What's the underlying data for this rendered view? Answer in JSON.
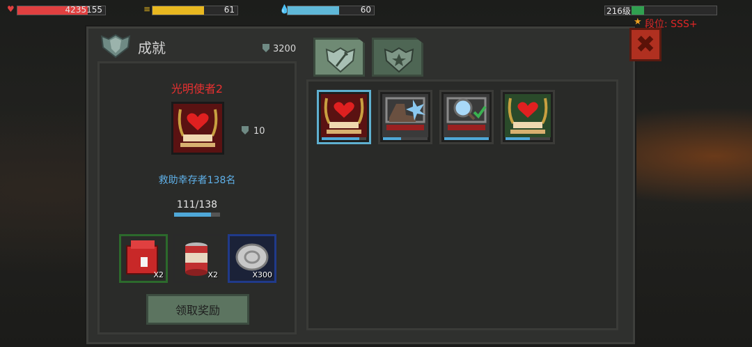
{
  "hud": {
    "health": {
      "value": "4235155",
      "fill": 0.8,
      "color": "#e04040"
    },
    "food": {
      "value": "61",
      "fill": 0.61,
      "color": "#e8b820"
    },
    "water": {
      "value": "60",
      "fill": 0.6,
      "color": "#5fb8d8"
    },
    "level": {
      "value": "216级",
      "fill": 0.15,
      "color": "#30a050"
    },
    "rank": "段位: SSS+"
  },
  "panel": {
    "title": "成就",
    "currency": "3200",
    "tabs": [
      {
        "id": "tab-achievements",
        "icon": "shield-sword-icon",
        "active": true
      },
      {
        "id": "tab-medals",
        "icon": "shield-star-icon",
        "active": false
      }
    ]
  },
  "detail": {
    "name": "光明使者2",
    "points": "10",
    "description": "救助幸存者138名",
    "progress_text": "111/138",
    "progress": 0.804,
    "rewards": [
      {
        "icon": "red-supply-crate-icon",
        "qty": "X2",
        "border": "#2c6a2c"
      },
      {
        "icon": "canned-food-icon",
        "qty": "X2",
        "border": "#2a2a2a"
      },
      {
        "icon": "silver-coin-icon",
        "qty": "X300",
        "border": "#203a8a"
      }
    ],
    "claim_label": "领取奖励"
  },
  "achievements": [
    {
      "icon": "heart-handshake-icon",
      "selected": true,
      "progress": 0.85,
      "bg": "#5a1212"
    },
    {
      "icon": "boot-ice-icon",
      "selected": false,
      "progress": 0.4,
      "bg": "#3a3a3a"
    },
    {
      "icon": "magnifier-check-icon",
      "selected": false,
      "progress": 1.0,
      "bg": "#3a3a3a"
    },
    {
      "icon": "heart-handshake-icon",
      "selected": false,
      "progress": 0.55,
      "bg": "#2a4a2a"
    }
  ]
}
